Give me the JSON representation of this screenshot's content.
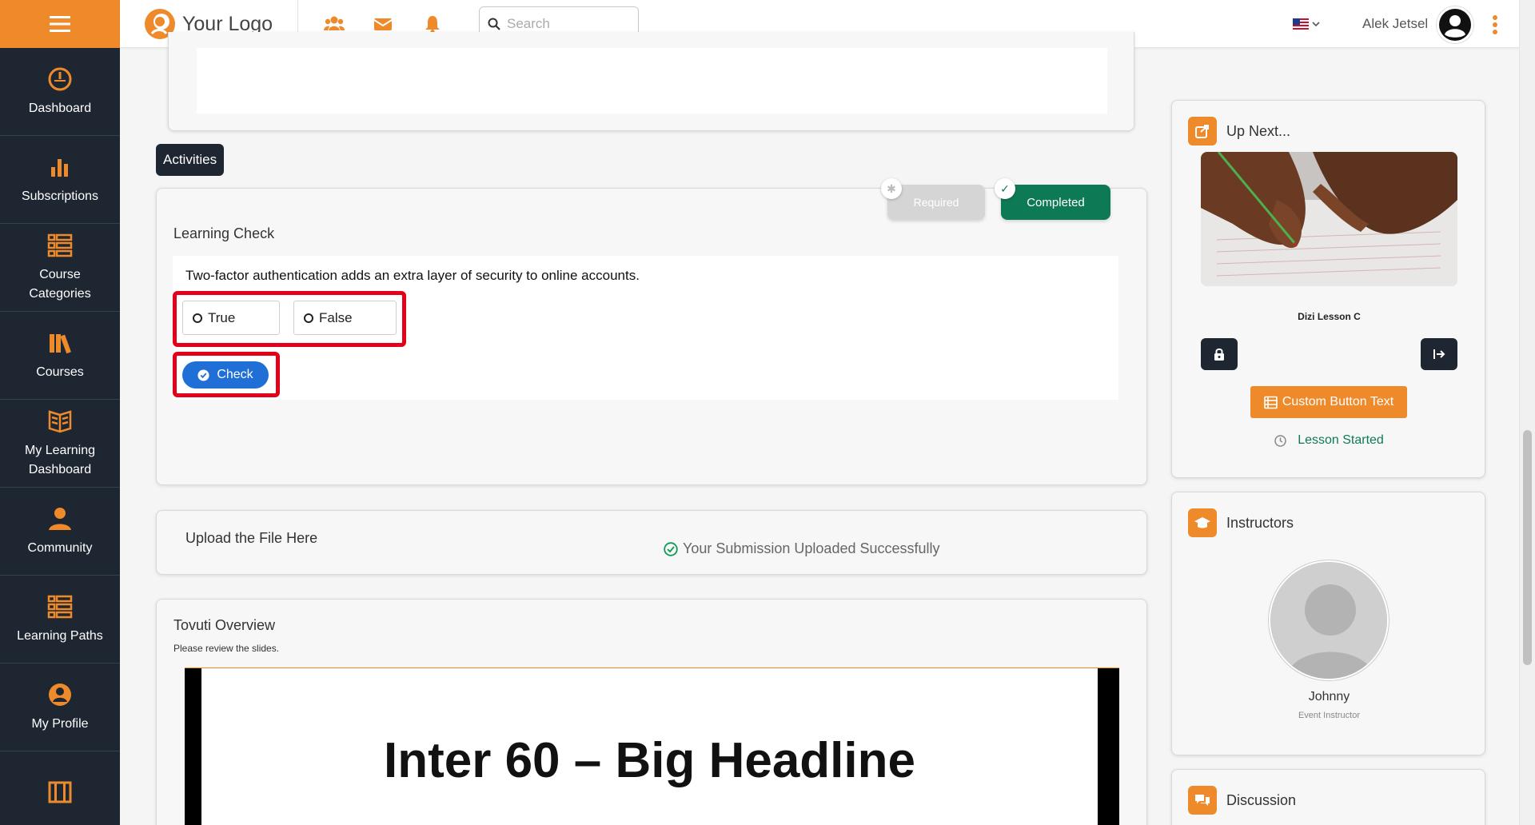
{
  "sidebar": {
    "menu_icon": "hamburger-menu-icon",
    "items": [
      {
        "label": "Dashboard",
        "icon": "speedometer-icon"
      },
      {
        "label": "Subscriptions",
        "icon": "bar-chart-icon"
      },
      {
        "label": "Course Categories",
        "icon": "list-grid-icon"
      },
      {
        "label": "Courses",
        "icon": "books-icon"
      },
      {
        "label": "My Learning Dashboard",
        "icon": "open-book-icon"
      },
      {
        "label": "Community",
        "icon": "person-community-icon"
      },
      {
        "label": "Learning Paths",
        "icon": "list-grid-icon"
      },
      {
        "label": "My Profile",
        "icon": "user-circle-icon"
      }
    ]
  },
  "header": {
    "logo_text": "Your Logo",
    "search_placeholder": "Search",
    "username": "Alek Jetsel",
    "language": "en-US"
  },
  "activities": {
    "tab_label": "Activities"
  },
  "learning_check": {
    "title": "Learning Check",
    "required_label": "Required",
    "completed_label": "Completed",
    "question": "Two-factor authentication adds an extra layer of security to online accounts.",
    "options": [
      "True",
      "False"
    ],
    "check_label": "Check"
  },
  "upload": {
    "title": "Upload the File Here",
    "status": "Your Submission Uploaded Successfully"
  },
  "overview": {
    "title": "Tovuti Overview",
    "subtitle": "Please review the slides.",
    "slide_headline": "Inter 60 – Big Headline"
  },
  "up_next": {
    "title": "Up Next...",
    "lesson_name": "Dizi Lesson C",
    "custom_button_label": "Custom Button Text",
    "status": "Lesson Started"
  },
  "instructors": {
    "title": "Instructors",
    "name": "Johnny",
    "role": "Event Instructor"
  },
  "discussion": {
    "title": "Discussion"
  },
  "colors": {
    "accent": "#ee8a2a",
    "sidebar_bg": "#1e2632",
    "success": "#0e7a55",
    "primary_button": "#1f6fd6",
    "highlight": "#e3001b"
  }
}
